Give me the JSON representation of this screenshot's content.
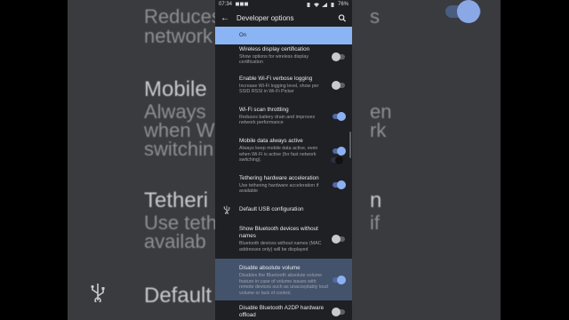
{
  "status_bar": {
    "time": "07:34",
    "battery": "76%"
  },
  "header": {
    "title": "Developer options"
  },
  "master": {
    "label": "On",
    "enabled": true
  },
  "items": [
    {
      "title": "Wireless display certification",
      "summary": "Show options for wireless display certification",
      "on": false
    },
    {
      "title": "Enable Wi-Fi verbose logging",
      "summary": "Increase Wi-Fi logging level, show per SSID RSSI in Wi-Fi Picker",
      "on": false
    },
    {
      "title": "Wi-Fi scan throttling",
      "summary": "Reduces battery drain and improves network performance",
      "on": true
    },
    {
      "title": "Mobile data always active",
      "summary": "Always keep mobile data active, even when Wi-Fi is active (for fast network switching).",
      "on": true
    },
    {
      "title": "Tethering hardware acceleration",
      "summary": "Use tethering hardware acceleration if available",
      "on": true
    },
    {
      "title": "Default USB configuration",
      "summary": "",
      "icon": "usb-icon"
    },
    {
      "title": "Show Bluetooth devices without names",
      "summary": "Bluetooth devices without names (MAC addresses only) will be displayed",
      "on": false
    },
    {
      "title": "Disable absolute volume",
      "summary": "Disables the Bluetooth absolute volume feature in case of volume issues with remote devices such as unacceptably loud volume or lack of control.",
      "on": true,
      "highlighted": true
    },
    {
      "title": "Disable Bluetooth A2DP hardware offload",
      "summary": "",
      "on": false
    }
  ],
  "background": {
    "left_lines": [
      "Reduces",
      "network",
      "Mobile",
      "Always",
      "when W",
      "switchin",
      "Tetheri",
      "Use teth",
      "availab",
      "Default"
    ],
    "right_lines": [
      "s",
      "en",
      "rk",
      "n",
      "if"
    ]
  },
  "colors": {
    "accent": "#8cb0f3",
    "highlight": "#44536c",
    "surface": "#1f2023"
  }
}
